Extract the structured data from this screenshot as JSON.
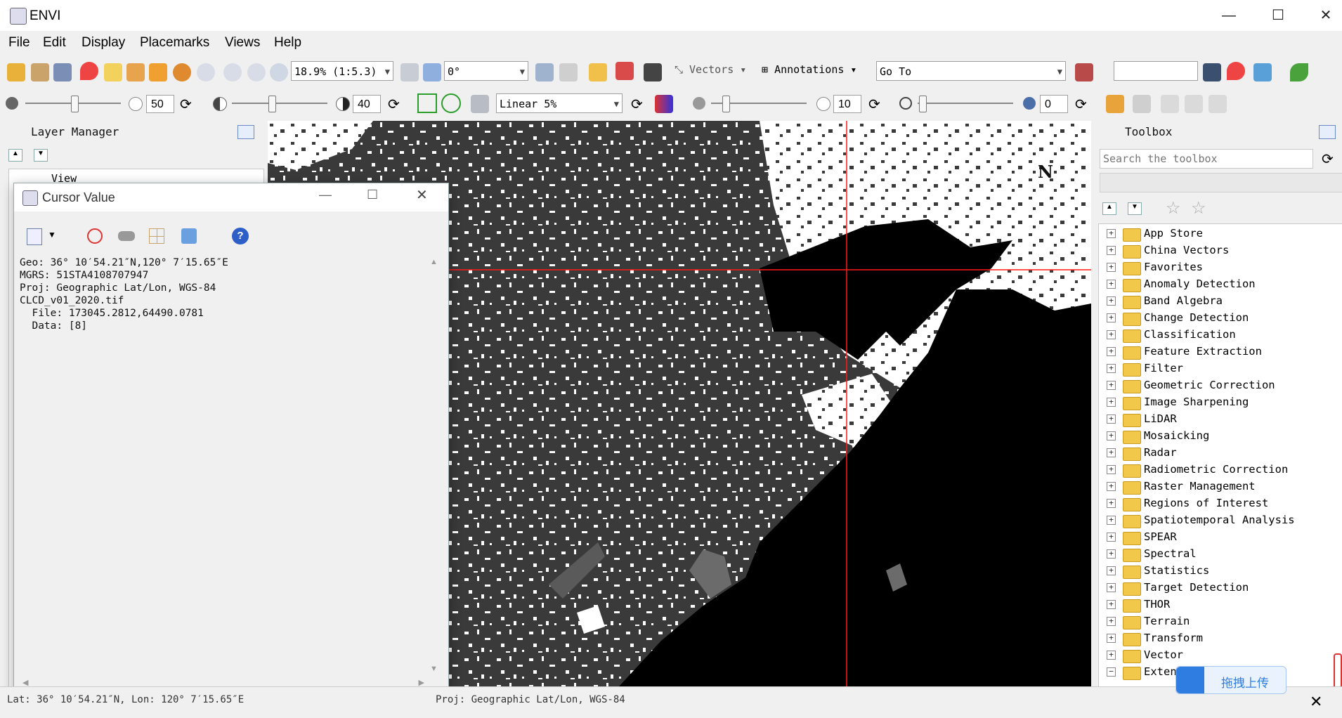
{
  "app": {
    "title": "ENVI"
  },
  "menu": [
    "File",
    "Edit",
    "Display",
    "Placemarks",
    "Views",
    "Help"
  ],
  "toolbar": {
    "zoom_value": "18.9% (1:5.3)",
    "rotation_value": "0°",
    "vectors_label": "Vectors",
    "annotations_label": "Annotations",
    "goto_value": "Go To"
  },
  "toolbar2": {
    "brightness_value": "50",
    "contrast_value": "40",
    "stretch_value": "Linear 5%",
    "sharpen_value": "10",
    "transparency_value": "0"
  },
  "layer_manager": {
    "title": "Layer Manager",
    "view_label": "View"
  },
  "cursor_value": {
    "title": "Cursor Value",
    "lines": [
      "Geo: 36° 10′54.21″N,120° 7′15.65″E",
      "MGRS: 51STA4108707947",
      "Proj: Geographic Lat/Lon, WGS-84",
      "",
      "CLCD_v01_2020.tif",
      "  File: 173045.2812,64490.0781",
      "  Data: [8]"
    ]
  },
  "map": {
    "north_label": "N"
  },
  "toolbox": {
    "title": "Toolbox",
    "search_placeholder": "Search the toolbox",
    "items": [
      "App Store",
      "China Vectors",
      "Favorites",
      "Anomaly Detection",
      "Band Algebra",
      "Change Detection",
      "Classification",
      "Feature Extraction",
      "Filter",
      "Geometric Correction",
      "Image Sharpening",
      "LiDAR",
      "Mosaicking",
      "Radar",
      "Radiometric Correction",
      "Raster Management",
      "Regions of Interest",
      "Spatiotemporal Analysis",
      "SPEAR",
      "Spectral",
      "Statistics",
      "Target Detection",
      "THOR",
      "Terrain",
      "Transform",
      "Vector",
      "Exten"
    ]
  },
  "upload_button": {
    "label": "拖拽上传"
  },
  "status": {
    "left": "Lat: 36° 10′54.21″N, Lon: 120° 7′15.65″E",
    "middle": "Proj: Geographic Lat/Lon, WGS-84"
  }
}
